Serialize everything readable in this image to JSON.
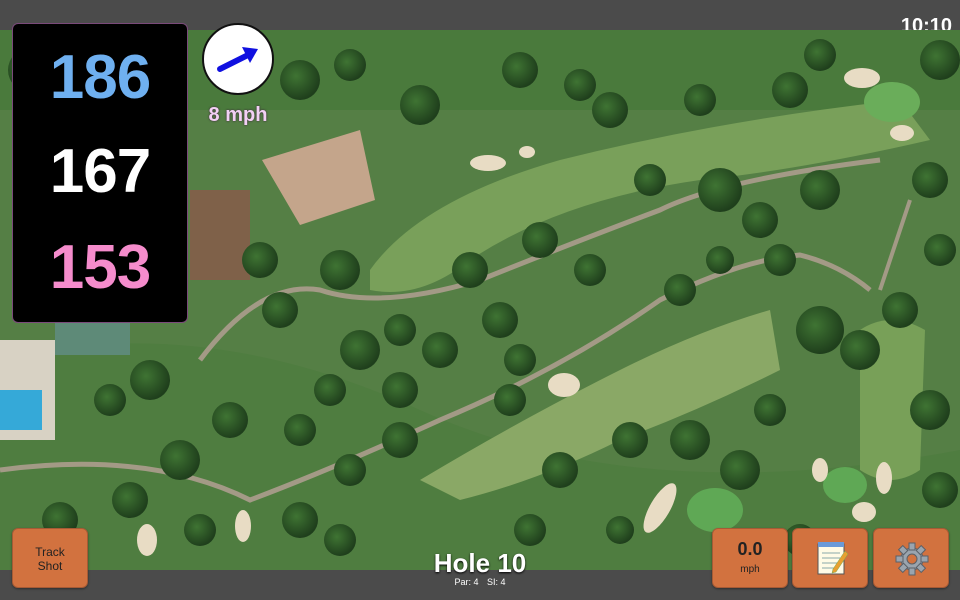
{
  "status_bar": {
    "time": "10:10"
  },
  "distances": {
    "back": "186",
    "middle": "167",
    "front": "153"
  },
  "wind": {
    "speed": "8 mph",
    "direction_icon": "arrow-icon",
    "arrow_color": "#1010e0"
  },
  "hole": {
    "title": "Hole 10",
    "par": "Par: 4",
    "si": "SI: 4"
  },
  "buttons": {
    "track_shot_line1": "Track",
    "track_shot_line2": "Shot",
    "speed_value": "0.0",
    "speed_unit": "mph",
    "notes_icon": "notepad-icon",
    "settings_icon": "gear-icon"
  },
  "colors": {
    "back_distance": "#6fb0f0",
    "middle_distance": "#ffffff",
    "front_distance": "#f58ccc",
    "button": "#d2723f"
  }
}
